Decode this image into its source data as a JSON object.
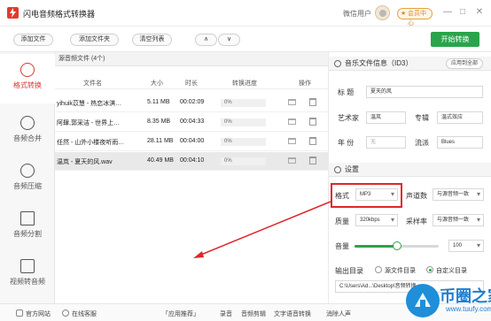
{
  "app": {
    "title": "闪电音频格式转换器",
    "user_label": "微信用户",
    "member_label": "会员中心",
    "window_buttons": [
      "—",
      "□",
      "✕"
    ]
  },
  "toolbar": {
    "add_file": "添加文件",
    "add_folder": "添加文件夹",
    "clear_list": "清空列表",
    "move_up": "∧",
    "move_down": "∨",
    "start": "开始转换"
  },
  "sidebar": {
    "items": [
      {
        "label": "格式转换",
        "icon": "refresh-icon",
        "active": true
      },
      {
        "label": "音频合并",
        "icon": "merge-icon",
        "active": false
      },
      {
        "label": "音频压缩",
        "icon": "music-note-icon",
        "active": false
      },
      {
        "label": "音频分割",
        "icon": "split-icon",
        "active": false
      },
      {
        "label": "视频转音频",
        "icon": "play-icon",
        "active": false
      }
    ]
  },
  "files": {
    "header": "源音频文件 (4个)",
    "columns": [
      "文件名",
      "大小",
      "时长",
      "转换进度",
      "操作"
    ],
    "rows": [
      {
        "name": "yihuik苡慧 - 热恋冰淇…",
        "size": "5.11 MB",
        "duration": "00:02:09",
        "progress": "0%"
      },
      {
        "name": "阿肆,郭采洁 - 世界上…",
        "size": "8.35 MB",
        "duration": "00:04:33",
        "progress": "0%"
      },
      {
        "name": "任然 - 山外小楼夜听雨…",
        "size": "28.11 MB",
        "duration": "00:04:00",
        "progress": "0%"
      },
      {
        "name": "温岚 - 夏天的风.wav",
        "size": "40.49 MB",
        "duration": "00:04:10",
        "progress": "0%"
      }
    ]
  },
  "info": {
    "header": "音乐文件信息（ID3）",
    "apply_all": "应用到全部",
    "title_label": "标 题",
    "title_value": "夏天的风",
    "artist_label": "艺术家",
    "artist_value": "温岚",
    "album_label": "专辑",
    "album_value": "温式效应",
    "year_label": "年 份",
    "year_value": "无",
    "genre_label": "流派",
    "genre_value": "Blues"
  },
  "settings": {
    "header": "设置",
    "format_label": "格式",
    "format_value": "MP3",
    "channel_label": "声道数",
    "channel_value": "与源音频一致",
    "quality_label": "质量",
    "quality_value": "320kbps",
    "samplerate_label": "采样率",
    "samplerate_value": "与源音频一致",
    "volume_label": "音量",
    "volume_value": "100",
    "volume_level": 0.5,
    "output_label": "输出目录",
    "output_source": "源文件目录",
    "output_custom": "自定义目录",
    "output_path": "C:\\Users\\Ad...\\Desktop\\音频转换"
  },
  "footer": {
    "website": "官方网站",
    "service": "在线客服",
    "recommend": "「应用推荐」",
    "links": [
      "录音",
      "音频剪辑",
      "文字语音转换",
      "消除人声"
    ]
  },
  "watermark": {
    "title": "币圈之家",
    "url": "www.tuufy.com"
  },
  "colors": {
    "accent": "#d43b2e",
    "green": "#2aa44a",
    "highlight": "#e0262a"
  }
}
